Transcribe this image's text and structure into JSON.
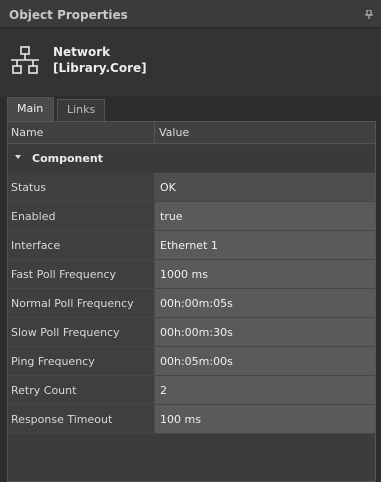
{
  "panel": {
    "title": "Object Properties",
    "pin_icon": "pin-icon"
  },
  "object": {
    "name": "Network",
    "library": "[Library.Core]",
    "icon": "network-icon"
  },
  "tabs": [
    {
      "label": "Main",
      "active": true
    },
    {
      "label": "Links",
      "active": false
    }
  ],
  "grid": {
    "columns": {
      "name": "Name",
      "value": "Value"
    },
    "category": "Component",
    "rows": [
      {
        "name": "Status",
        "value": "OK"
      },
      {
        "name": "Enabled",
        "value": "true"
      },
      {
        "name": "Interface",
        "value": "Ethernet 1"
      },
      {
        "name": "Fast Poll Frequency",
        "value": "1000 ms"
      },
      {
        "name": "Normal Poll Frequency",
        "value": "00h:00m:05s"
      },
      {
        "name": "Slow Poll Frequency",
        "value": "00h:00m:30s"
      },
      {
        "name": "Ping Frequency",
        "value": "00h:05m:00s"
      },
      {
        "name": "Retry Count",
        "value": "2"
      },
      {
        "name": "Response Timeout",
        "value": "100 ms"
      }
    ]
  },
  "colors": {
    "background": "#2d2d2d",
    "value_cell": "#5a5a5a",
    "name_cell": "#3f3f3f"
  }
}
